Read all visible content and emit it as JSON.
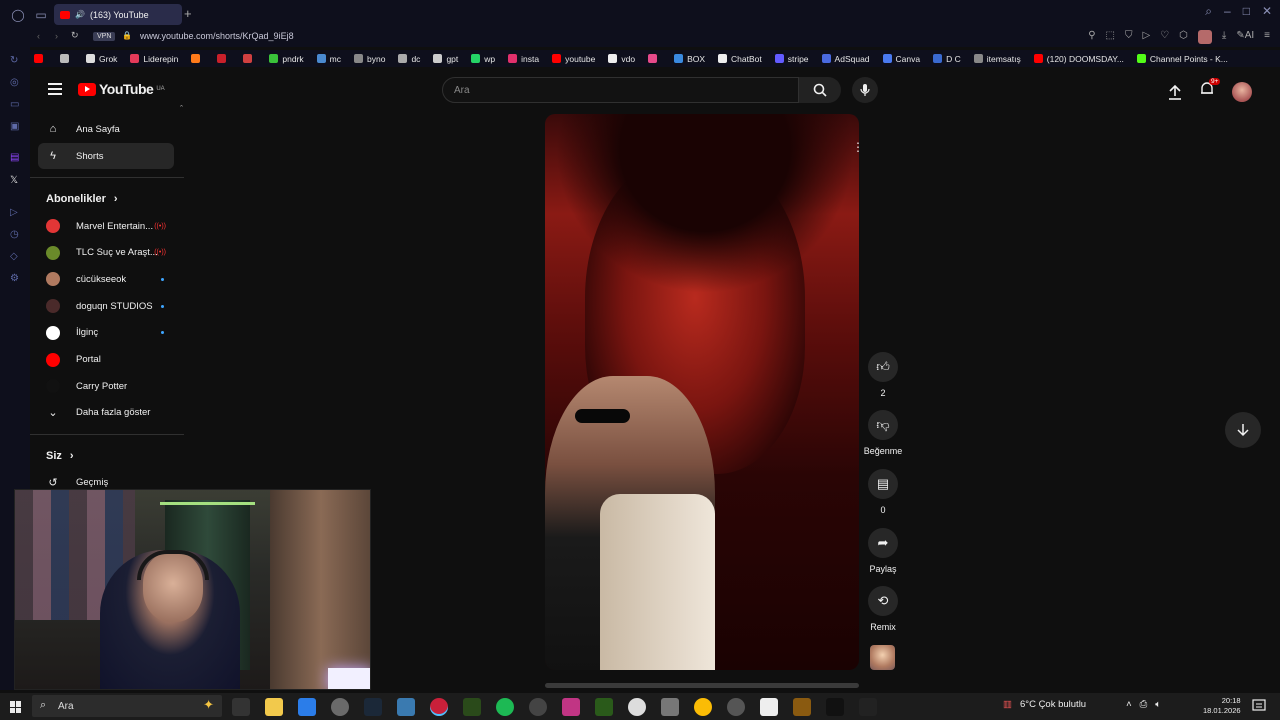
{
  "browser": {
    "tab_title": "(163) YouTube",
    "url": "www.youtube.com/shorts/KrQad_9iEj8",
    "vpn_label": "VPN"
  },
  "bookmarks": [
    {
      "label": "",
      "color": "#ff0000"
    },
    {
      "label": "",
      "color": "#bbbbbb"
    },
    {
      "label": "Grok",
      "color": "#dddddd"
    },
    {
      "label": "Liderepin",
      "color": "#e43a5a"
    },
    {
      "label": "",
      "color": "#ff7a1a"
    },
    {
      "label": "",
      "color": "#c9202a"
    },
    {
      "label": "",
      "color": "#d04040"
    },
    {
      "label": "pndrk",
      "color": "#3ac23a"
    },
    {
      "label": "mc",
      "color": "#4a8ad0"
    },
    {
      "label": "byno",
      "color": "#888888"
    },
    {
      "label": "dc",
      "color": "#aaaaaa"
    },
    {
      "label": "gpt",
      "color": "#cccccc"
    },
    {
      "label": "wp",
      "color": "#25d366"
    },
    {
      "label": "insta",
      "color": "#e1306c"
    },
    {
      "label": "youtube",
      "color": "#ff0000"
    },
    {
      "label": "vdo",
      "color": "#eeeeee"
    },
    {
      "label": "",
      "color": "#e64a8a"
    },
    {
      "label": "BOX",
      "color": "#3a8ae0"
    },
    {
      "label": "ChatBot",
      "color": "#eeeeee"
    },
    {
      "label": "stripe",
      "color": "#635bff"
    },
    {
      "label": "AdSquad",
      "color": "#4a6ae0"
    },
    {
      "label": "Canva",
      "color": "#4a7af0"
    },
    {
      "label": "D C",
      "color": "#3a6ad0"
    },
    {
      "label": "itemsatış",
      "color": "#888888"
    },
    {
      "label": "(120) DOOMSDAY...",
      "color": "#ff0000"
    },
    {
      "label": "Channel Points - K...",
      "color": "#53fc18"
    }
  ],
  "youtube": {
    "logo_text": "YouTube",
    "logo_region": "UA",
    "search_placeholder": "Ara",
    "notification_count": "9+",
    "nav": [
      {
        "label": "Ana Sayfa",
        "icon": "home-icon"
      },
      {
        "label": "Shorts",
        "icon": "shorts-icon"
      }
    ],
    "subscriptions_header": "Abonelikler",
    "subscriptions": [
      {
        "label": "Marvel Entertain...",
        "color": "#e23636",
        "status": "live"
      },
      {
        "label": "TLC Suç ve Araşt...",
        "color": "#6a8a2a",
        "status": "live"
      },
      {
        "label": "cücükseeok",
        "color": "#b07a60",
        "status": "new"
      },
      {
        "label": "doguqn STUDIOS",
        "color": "#4a2a2a",
        "status": "new"
      },
      {
        "label": "İlginç",
        "color": "#ffffff",
        "status": "new"
      },
      {
        "label": "Portal",
        "color": "#ff0000",
        "status": ""
      },
      {
        "label": "Carry Potter",
        "color": "#111111",
        "status": ""
      }
    ],
    "show_more": "Daha fazla göster",
    "you_header": "Siz",
    "history": "Geçmiş",
    "actions": {
      "like_count": "2",
      "dislike_label": "Beğenme",
      "comment_count": "0",
      "share_label": "Paylaş",
      "remix_label": "Remix"
    }
  },
  "taskbar": {
    "search_placeholder": "Ara",
    "weather": "6°C  Çok bulutlu",
    "time": "20:18",
    "date": "18.01.2026"
  }
}
